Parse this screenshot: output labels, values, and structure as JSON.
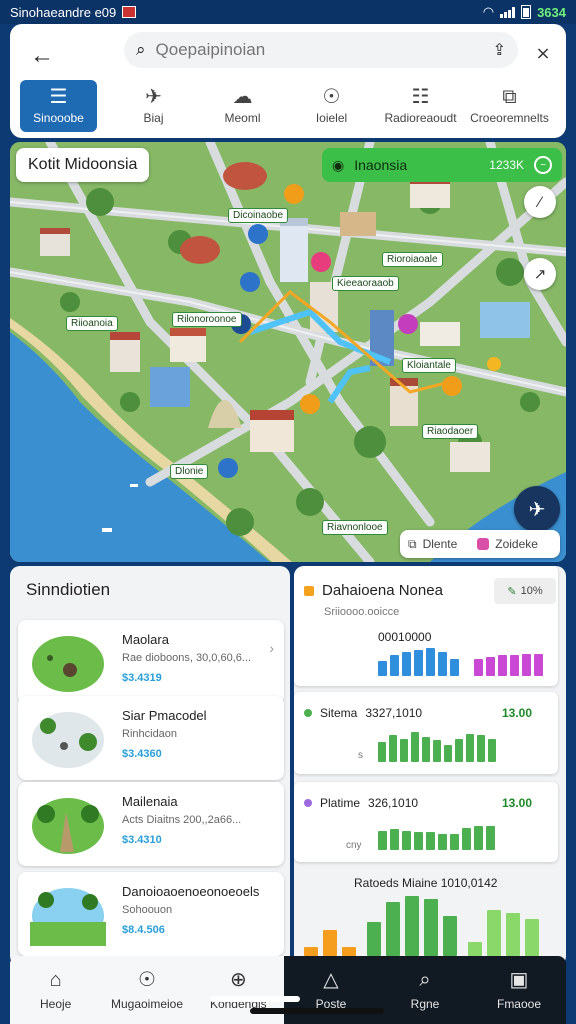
{
  "status": {
    "carrier": "Sinohaeandre e09",
    "time": "3634"
  },
  "search": {
    "placeholder": "Qoepaipinoian",
    "back_icon": "back-arrow-icon",
    "scan_icon": "scan-icon",
    "more_icon": "share-icon"
  },
  "tabs": [
    {
      "label": "Sinooobe",
      "icon": "list-icon",
      "active": true
    },
    {
      "label": "Biaj",
      "icon": "plane-icon"
    },
    {
      "label": "Meoml",
      "icon": "cloud-icon"
    },
    {
      "label": "Ioielel",
      "icon": "magnifier-icon"
    },
    {
      "label": "Radioreaoudt",
      "icon": "document-icon"
    },
    {
      "label": "Croeoremnelts",
      "icon": "ruler-icon"
    }
  ],
  "map": {
    "title": "Kotit Midoonsia",
    "region_chip": {
      "label": "Inaonsia",
      "value": "1233K"
    },
    "labels": [
      "Dicoinaobe",
      "Rioroiaoale",
      "Kieeaoraaob",
      "Riioanoia",
      "Rilonoroonoe",
      "Kloiantale",
      "Riaodaoer",
      "Dlonie",
      "Riavnonlooe"
    ],
    "legend": {
      "item1": "Dlente",
      "item2": "Zoideke"
    }
  },
  "left_panel": {
    "title": "Sinndiotien",
    "places": [
      {
        "name": "Maolara",
        "desc": "Rae dioboons, 30,0,60,6...",
        "price": "$3.4319"
      },
      {
        "name": "Siar Pmacodel",
        "desc": "Rinhcidaon",
        "price": "$3.4360"
      },
      {
        "name": "Mailenaia",
        "desc": "Acts Diaitns 200,,2a66...",
        "price": "$3.4310"
      },
      {
        "name": "Danoioaoenoeonoeoels",
        "desc": "Sohoouon",
        "price": "$8.4.506"
      }
    ]
  },
  "right_panel": {
    "title": "Dahaioena Nonea",
    "badge": "10%",
    "subtitle": "Sriioooo.ooicce",
    "value_line": "00010000",
    "metrics": [
      {
        "label": "Sitema",
        "code": "3327,1010",
        "value": "13.00",
        "color": "#4caf50"
      },
      {
        "label": "Platime",
        "code": "326,1010",
        "value": "13.00",
        "color": "#9c6ade"
      }
    ],
    "axis_labels": [
      "s",
      "cny",
      "s"
    ],
    "summary": "Ratoeds Miaine 1010,0142"
  },
  "bottom_nav": [
    {
      "label": "Heoje",
      "icon": "home-icon"
    },
    {
      "label": "Mugaoimeioe",
      "icon": "compass-icon"
    },
    {
      "label": "Kondendis",
      "icon": "chat-icon"
    },
    {
      "label": "Poste",
      "icon": "triangle-icon"
    },
    {
      "label": "Rgne",
      "icon": "search-icon"
    },
    {
      "label": "Fmaooe",
      "icon": "inbox-icon"
    }
  ],
  "chart_data": [
    {
      "type": "bar",
      "title": "Dahaioena Nonea",
      "series": [
        {
          "name": "",
          "color": "#2f8fdc",
          "values": [
            8,
            11,
            13,
            14,
            15,
            13,
            9
          ]
        },
        {
          "name": "",
          "color": "#c949d4",
          "values": [
            9,
            10,
            11,
            11,
            12,
            12
          ]
        }
      ]
    },
    {
      "type": "bar",
      "title": "Sitema",
      "series": [
        {
          "name": "Sitema",
          "color": "#4caf50",
          "values": [
            12,
            16,
            14,
            18,
            15,
            13,
            10,
            14,
            17,
            16,
            14
          ]
        }
      ]
    },
    {
      "type": "bar",
      "title": "Platime",
      "series": [
        {
          "name": "Platime",
          "color": "#4caf50",
          "values": [
            12,
            13,
            12,
            11,
            11,
            10,
            10,
            14,
            15,
            15
          ]
        }
      ]
    },
    {
      "type": "bar",
      "title": "Ratoeds Miaine 1010,0142",
      "series": [
        {
          "name": "",
          "color": "#f59e1e",
          "values": [
            6,
            18,
            6
          ]
        },
        {
          "name": "",
          "color": "#4caf50",
          "values": [
            24,
            38,
            42,
            40,
            28
          ]
        },
        {
          "name": "",
          "color": "#8bd86a",
          "values": [
            10,
            32,
            30,
            26
          ]
        }
      ]
    }
  ]
}
